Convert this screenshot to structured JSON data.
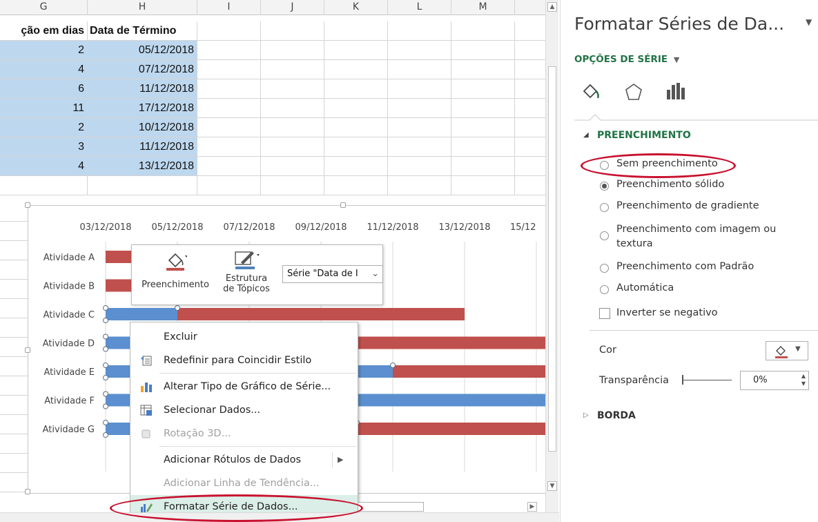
{
  "sheet": {
    "col_headers": [
      "G",
      "H",
      "I",
      "J",
      "K",
      "L",
      "M"
    ],
    "table_header": [
      "ção em dias",
      "Data de Término"
    ],
    "rows": [
      [
        "2",
        "05/12/2018"
      ],
      [
        "4",
        "07/12/2018"
      ],
      [
        "6",
        "11/12/2018"
      ],
      [
        "11",
        "17/12/2018"
      ],
      [
        "2",
        "10/12/2018"
      ],
      [
        "3",
        "11/12/2018"
      ],
      [
        "4",
        "13/12/2018"
      ]
    ]
  },
  "chart_data": {
    "type": "bar",
    "orientation": "horizontal",
    "stacked": true,
    "categories": [
      "Atividade A",
      "Atividade B",
      "Atividade C",
      "Atividade D",
      "Atividade E",
      "Atividade F",
      "Atividade G"
    ],
    "x_tick_labels": [
      "03/12/2018",
      "05/12/2018",
      "07/12/2018",
      "09/12/2018",
      "11/12/2018",
      "13/12/2018",
      "15/12"
    ],
    "x_axis_position": "top",
    "xlim": [
      "03/12/2018",
      "15/12/2018"
    ],
    "gridlines": true,
    "series": [
      {
        "color": "#5b8fcf",
        "values": [
          null,
          null,
          "05/12/2018",
          "07/12/2018",
          "11/12/2018",
          "17/12/2018",
          "10/12/2018"
        ]
      },
      {
        "name": "Data de Término",
        "color": "#c0504d",
        "values": [
          null,
          null,
          "11/12/2018",
          "17/12/2018",
          "10/12/2018",
          "11/12/2018",
          "13/12/2018"
        ]
      }
    ]
  },
  "mini_toolbar": {
    "fill_label": "Preenchimento",
    "outline_label_1": "Estrutura",
    "outline_label_2": "de Tópicos",
    "series_select": "Série \"Data de I"
  },
  "context_menu": {
    "items": [
      {
        "label": "Excluir",
        "icon": "none",
        "disabled": false
      },
      {
        "label": "Redefinir para Coincidir Estilo",
        "icon": "reset-style-icon",
        "disabled": false
      },
      {
        "label": "Alterar Tipo de Gráfico de Série...",
        "icon": "chart-type-icon",
        "disabled": false
      },
      {
        "label": "Selecionar Dados...",
        "icon": "select-data-icon",
        "disabled": false
      },
      {
        "label": "Rotação 3D...",
        "icon": "rotation-3d-icon",
        "disabled": true
      },
      {
        "label": "Adicionar Rótulos de Dados",
        "icon": "none",
        "disabled": false,
        "submenu": true
      },
      {
        "label": "Adicionar Linha de Tendência...",
        "icon": "none",
        "disabled": true
      },
      {
        "label": "Formatar Série de Dados...",
        "icon": "format-series-icon",
        "disabled": false,
        "highlighted": true
      }
    ]
  },
  "pane": {
    "title": "Formatar Séries de Da...",
    "options_label": "OPÇÕES DE SÉRIE",
    "fill_section": "PREENCHIMENTO",
    "fill_options": [
      {
        "label": "Sem preenchimento",
        "selected": false
      },
      {
        "label": "Preenchimento sólido",
        "selected": true
      },
      {
        "label": "Preenchimento de gradiente",
        "selected": false
      },
      {
        "label": "Preenchimento com imagem ou",
        "selected": false
      },
      {
        "label": "Preenchimento  com Padrão",
        "selected": false
      },
      {
        "label": "Automática",
        "selected": false
      }
    ],
    "fill_option_wrap": "textura",
    "invert_label": "Inverter se negativo",
    "color_label": "Cor",
    "transparency_label": "Transparência",
    "transparency_value": "0%",
    "border_section": "BORDA",
    "accent_color": "#217346",
    "annotation_color": "#c8102e"
  }
}
